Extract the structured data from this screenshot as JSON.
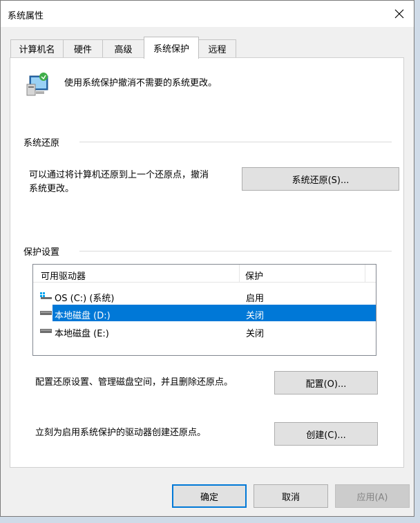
{
  "window": {
    "title": "系统属性"
  },
  "tabs": [
    {
      "label": "计算机名"
    },
    {
      "label": "硬件"
    },
    {
      "label": "高级"
    },
    {
      "label": "系统保护"
    },
    {
      "label": "远程"
    }
  ],
  "active_tab": "系统保护",
  "intro": {
    "text": "使用系统保护撤消不需要的系统更改。"
  },
  "restore": {
    "group_label": "系统还原",
    "desc_line1": "可以通过将计算机还原到上一个还原点，撤消",
    "desc_line2": "系统更改。",
    "button_label": "系统还原(S)..."
  },
  "protection": {
    "group_label": "保护设置",
    "columns": {
      "drive": "可用驱动器",
      "status": "保护"
    },
    "drives": [
      {
        "name": "OS (C:) (系统)",
        "status": "启用",
        "selected": false
      },
      {
        "name": "本地磁盘 (D:)",
        "status": "关闭",
        "selected": true
      },
      {
        "name": "本地磁盘 (E:)",
        "status": "关闭",
        "selected": false
      }
    ],
    "configure_text": "配置还原设置、管理磁盘空间，并且删除还原点。",
    "configure_button": "配置(O)...",
    "create_text": "立刻为启用系统保护的驱动器创建还原点。",
    "create_button": "创建(C)..."
  },
  "footer": {
    "ok": "确定",
    "cancel": "取消",
    "apply": "应用(A)"
  },
  "colors": {
    "accent": "#0078d7",
    "panel": "#ffffff",
    "dialog": "#f0f0f0"
  }
}
